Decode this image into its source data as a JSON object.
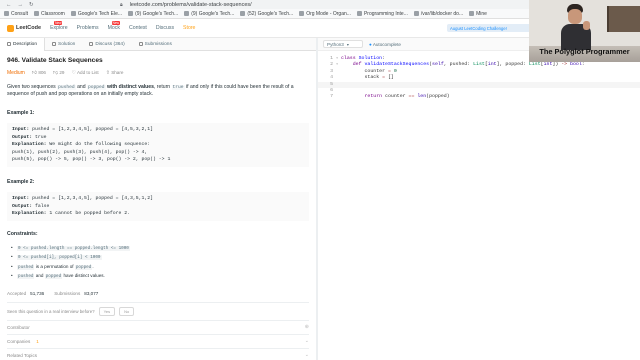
{
  "browser": {
    "url": "leetcode.com/problems/validate-stack-sequences/"
  },
  "bookmarks": [
    {
      "label": "Consult"
    },
    {
      "label": "Classroom"
    },
    {
      "label": "Google's Tech Ele..."
    },
    {
      "label": "(9) Google's Tech..."
    },
    {
      "label": "(9) Google's Tech..."
    },
    {
      "label": "(52) Google's Tech..."
    },
    {
      "label": "Org Mode - Organ..."
    },
    {
      "label": "Programming Inte..."
    },
    {
      "label": "/var/lib/docker do..."
    },
    {
      "label": "Mine"
    }
  ],
  "topnav": {
    "logo": "LeetCode",
    "items": [
      {
        "label": "Explore",
        "badge": "New"
      },
      {
        "label": "Problems",
        "badge": ""
      },
      {
        "label": "Mock",
        "badge": "New"
      },
      {
        "label": "Contest",
        "badge": ""
      },
      {
        "label": "Discuss",
        "badge": ""
      },
      {
        "label": "Store",
        "badge": ""
      }
    ],
    "promo": "August LeetCoding Challenge!"
  },
  "tabs": [
    "Description",
    "Solution",
    "Discuss (364)",
    "Submissions"
  ],
  "problem": {
    "title": "946. Validate Stack Sequences",
    "difficulty": "Medium",
    "likes": "806",
    "dislikes": "29",
    "add_to_list": "Add to List",
    "share": "Share",
    "desc_parts": [
      "Given two sequences ",
      "pushed",
      " and ",
      "popped",
      " with distinct values",
      ", return ",
      "true",
      " if and only if this could have been the result of a sequence of push and pop operations on an initially empty stack."
    ],
    "ex1_title": "Example 1:",
    "ex1_lines": [
      [
        "Input: ",
        "pushed = [1,2,3,4,5], popped = [4,5,3,2,1]"
      ],
      [
        "Output: ",
        "true"
      ],
      [
        "Explanation: ",
        "We might do the following sequence:"
      ],
      [
        "",
        "push(1), push(2), push(3), push(4), pop() -> 4,"
      ],
      [
        "",
        "push(5), pop() -> 5, pop() -> 3, pop() -> 2, pop() -> 1"
      ]
    ],
    "ex2_title": "Example 2:",
    "ex2_lines": [
      [
        "Input: ",
        "pushed = [1,2,3,4,5], popped = [4,3,5,1,2]"
      ],
      [
        "Output: ",
        "false"
      ],
      [
        "Explanation: ",
        "1 cannot be popped before 2."
      ]
    ],
    "constraints_title": "Constraints:",
    "constraints": [
      [
        "0 <= pushed.length == popped.length <= 1000"
      ],
      [
        "0 <= pushed[i], popped[i] < 1000"
      ],
      [
        "pushed",
        " is a permutation of ",
        "popped",
        "."
      ],
      [
        "pushed",
        " and ",
        "popped",
        " have distinct values."
      ]
    ],
    "accepted_label": "Accepted",
    "accepted": "51,736",
    "submissions_label": "Submissions",
    "submissions": "83,077",
    "seen_q": "Seen this question in a real interview before?",
    "yes": "Yes",
    "no": "No",
    "rows": [
      {
        "label": "Contributor",
        "icon": "+"
      },
      {
        "label": "Companies",
        "icon": "v"
      },
      {
        "label": "Related Topics",
        "icon": "v"
      }
    ],
    "companies_badge": "1"
  },
  "editor": {
    "language": "Python3",
    "autocomplete": "Autocomplete",
    "line_numbers": [
      "1",
      "2",
      "3",
      "4",
      "5",
      "6",
      "7"
    ],
    "lines": [
      [
        [
          "kw",
          "class "
        ],
        [
          "df",
          "Solution"
        ],
        [
          "pn",
          ":"
        ]
      ],
      [
        [
          "pn",
          "    "
        ],
        [
          "kw",
          "def "
        ],
        [
          "df",
          "validateStackSequences"
        ],
        [
          "pn",
          "("
        ],
        [
          "bi",
          "self"
        ],
        [
          "pn",
          ", pushed: "
        ],
        [
          "ty",
          "List"
        ],
        [
          "pn",
          "["
        ],
        [
          "bi",
          "int"
        ],
        [
          "pn",
          "], popped: "
        ],
        [
          "ty",
          "List"
        ],
        [
          "pn",
          "["
        ],
        [
          "bi",
          "int"
        ],
        [
          "pn",
          "]) "
        ],
        [
          "op",
          "->"
        ],
        [
          "pn",
          " "
        ],
        [
          "bi",
          "bool"
        ],
        [
          "pn",
          ":"
        ]
      ],
      [
        [
          "pn",
          "        counter "
        ],
        [
          "op",
          "="
        ],
        [
          "pn",
          " "
        ],
        [
          "nm",
          "0"
        ]
      ],
      [
        [
          "pn",
          "        stack "
        ],
        [
          "op",
          "="
        ],
        [
          "pn",
          " []"
        ]
      ],
      [],
      [],
      [
        [
          "pn",
          "        "
        ],
        [
          "kw",
          "return "
        ],
        [
          "pn",
          "counter "
        ],
        [
          "op",
          "=="
        ],
        [
          "pn",
          " "
        ],
        [
          "bi",
          "len"
        ],
        [
          "pn",
          "(popped)"
        ]
      ]
    ]
  },
  "webcam": {
    "caption": "The Polyglot Programmer"
  }
}
